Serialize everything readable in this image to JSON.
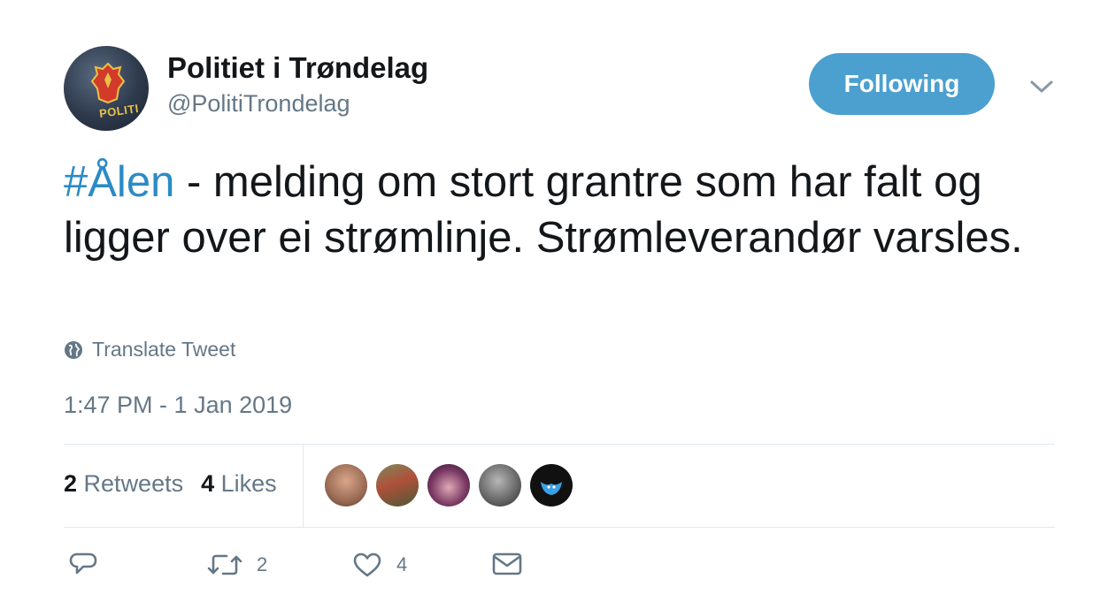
{
  "tweet": {
    "author": {
      "display_name": "Politiet i Trøndelag",
      "handle": "@PolitiTrondelag",
      "avatar_icon": "police-crest-avatar",
      "avatar_text": "POLITI"
    },
    "follow_button_label": "Following",
    "text": {
      "hashtag": "#Ålen",
      "body": " - melding om stort grantre som har falt og ligger over ei strømlinje.  Strømleverandør varsles."
    },
    "translate_label": "Translate Tweet",
    "timestamp": "1:47 PM - 1 Jan 2019",
    "stats": {
      "retweets_count": "2",
      "retweets_label": "Retweets",
      "likes_count": "4",
      "likes_label": "Likes"
    },
    "likers": [
      {
        "icon": "liker-avatar-1"
      },
      {
        "icon": "liker-avatar-2"
      },
      {
        "icon": "liker-avatar-3"
      },
      {
        "icon": "liker-avatar-4"
      },
      {
        "icon": "liker-avatar-5"
      }
    ],
    "actions": {
      "reply_icon": "reply-icon",
      "retweet_icon": "retweet-icon",
      "retweet_count": "2",
      "like_icon": "heart-icon",
      "like_count": "4",
      "dm_icon": "envelope-icon"
    }
  },
  "colors": {
    "accent": "#4ba0cf",
    "hashtag": "#2b8bc4",
    "muted": "#657786",
    "text": "#14171a",
    "divider": "#e1e8ed"
  }
}
